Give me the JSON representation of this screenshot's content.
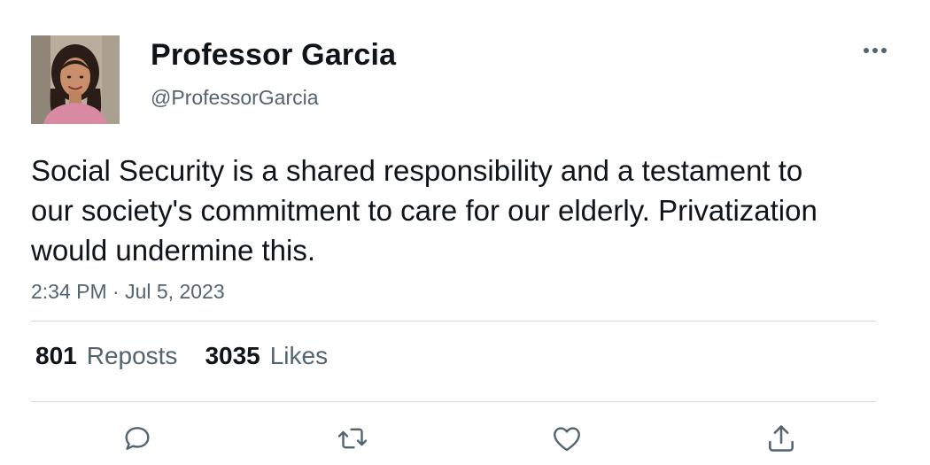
{
  "author": {
    "display_name": "Professor Garcia",
    "handle": "@ProfessorGarcia"
  },
  "tweet": {
    "text": "Social Security is a shared responsibility and a testament to our society's commitment to care for our elderly. Privatization would undermine this.",
    "timestamp": "2:34 PM · Jul 5, 2023"
  },
  "stats": {
    "reposts_count": "801",
    "reposts_label": "Reposts",
    "likes_count": "3035",
    "likes_label": "Likes"
  },
  "icons": {
    "more": "more-horizontal-icon",
    "reply": "reply-icon",
    "repost": "repost-icon",
    "like": "heart-icon",
    "share": "share-icon"
  },
  "colors": {
    "text_primary": "#0f1419",
    "text_secondary": "#536471",
    "divider": "#cfd9de"
  }
}
